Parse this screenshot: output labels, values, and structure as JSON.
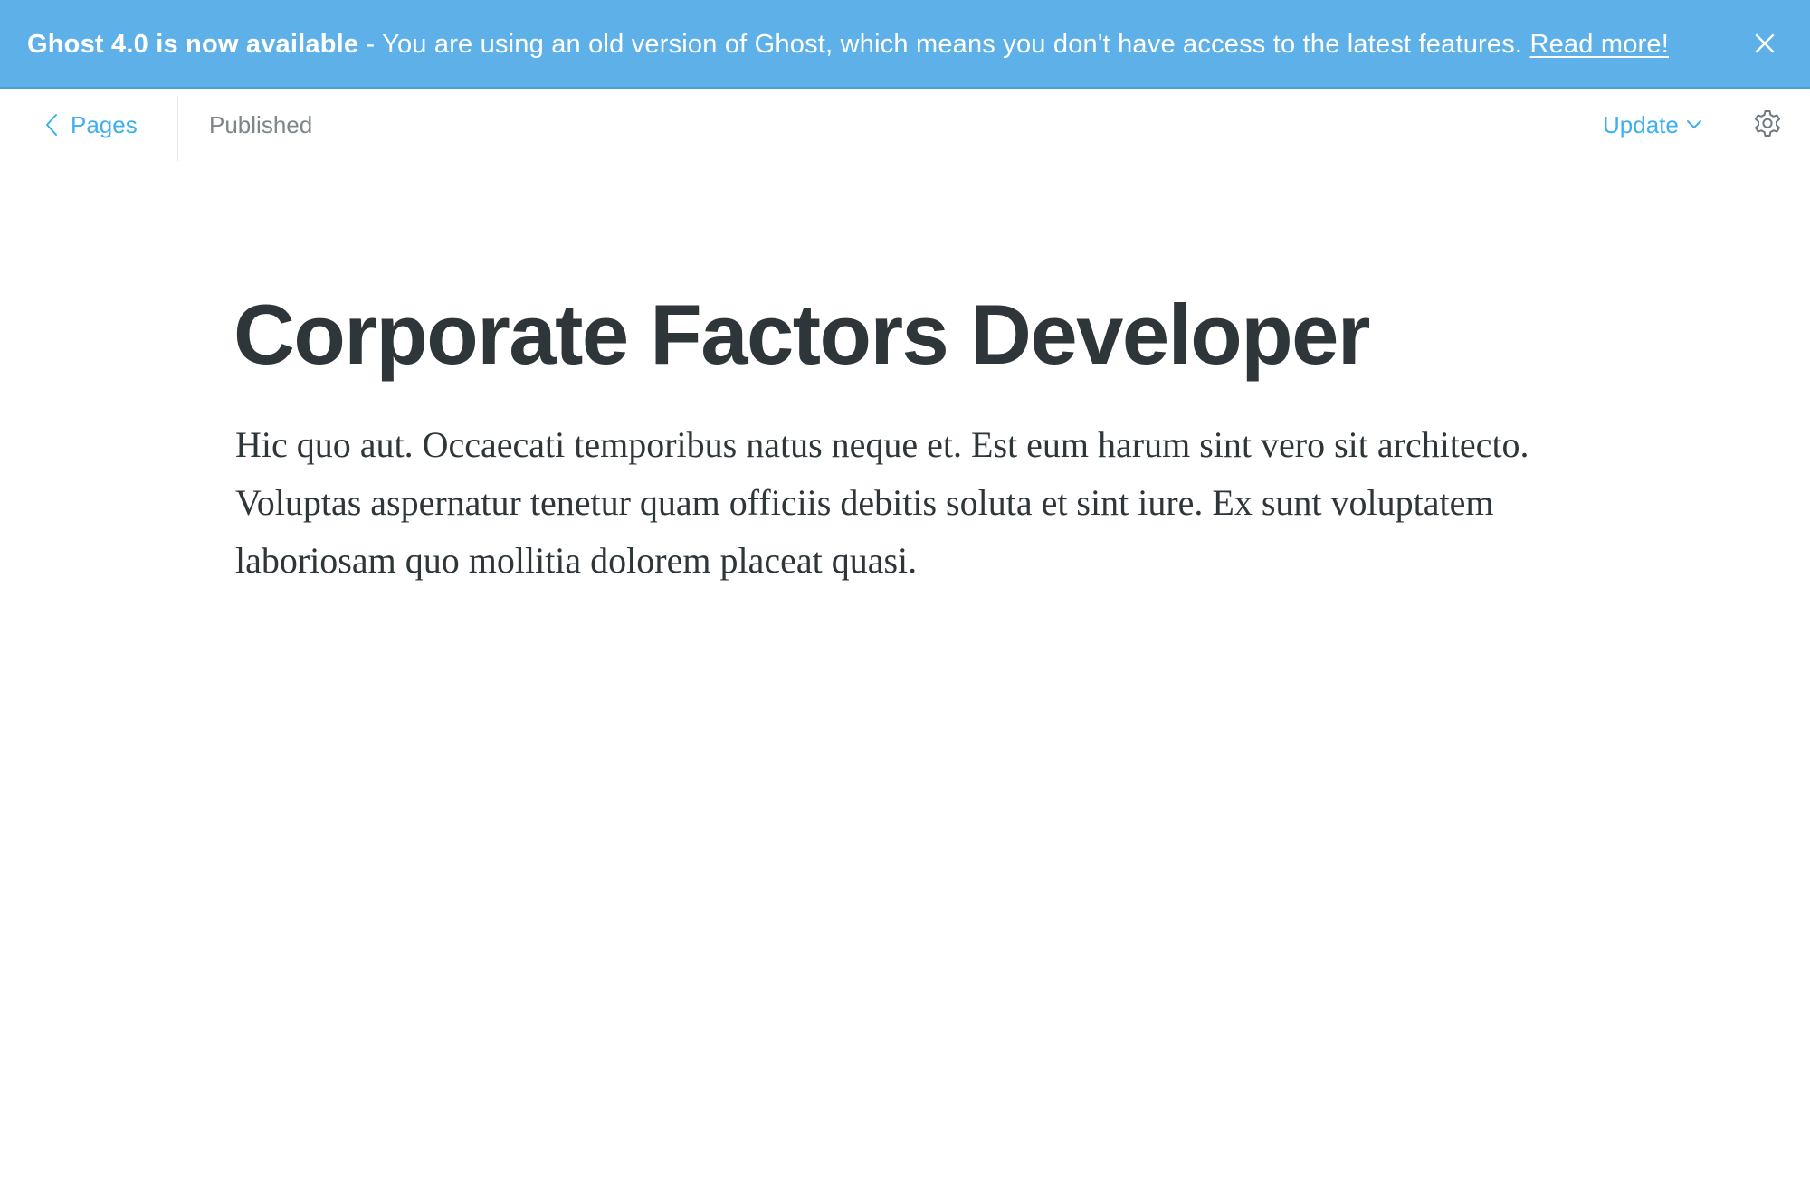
{
  "banner": {
    "headline": "Ghost 4.0 is now available",
    "message": " - You are using an old version of Ghost, which means you don't have access to the latest features. ",
    "link_label": "Read more!"
  },
  "header": {
    "back_label": "Pages",
    "status": "Published",
    "update_label": "Update"
  },
  "post": {
    "title": "Corporate Factors Developer",
    "body": "Hic quo aut. Occaecati temporibus natus neque et. Est eum harum sint vero sit architecto. Voluptas aspernatur tenetur quam officiis debitis soluta et sint iure. Ex sunt voluptatem laboriosam quo mollitia dolorem placeat quasi."
  },
  "colors": {
    "banner_bg": "#5eb1e8",
    "accent": "#3eb0ef",
    "text": "#2e3639",
    "muted": "#7d878a"
  }
}
